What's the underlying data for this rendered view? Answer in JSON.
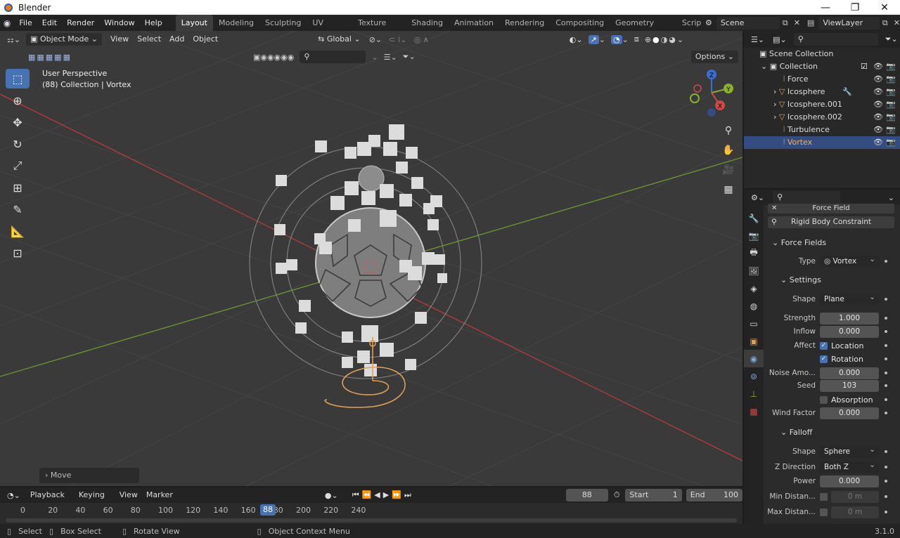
{
  "window": {
    "title": "Blender",
    "min": "—",
    "max": "❐",
    "close": "✕"
  },
  "menu": [
    "File",
    "Edit",
    "Render",
    "Window",
    "Help"
  ],
  "workspaces": [
    "Layout",
    "Modeling",
    "Sculpting",
    "UV Editing",
    "Texture Paint",
    "Shading",
    "Animation",
    "Rendering",
    "Compositing",
    "Geometry Nodes",
    "Scripting"
  ],
  "scene": {
    "name": "Scene",
    "view_layer": "ViewLayer"
  },
  "viewport": {
    "mode": "Object Mode",
    "menus": [
      "View",
      "Select",
      "Add",
      "Object"
    ],
    "orientation": "Global",
    "options": "Options",
    "perspective": "User Perspective",
    "collection_info": "(88) Collection | Vortex",
    "last_op": "Move",
    "gizmo": {
      "x": "X",
      "y": "Y",
      "z": "Z"
    }
  },
  "outliner": {
    "root": "Scene Collection",
    "collection": "Collection",
    "items": [
      "Force",
      "Icosphere",
      "Icosphere.001",
      "Icosphere.002",
      "Turbulence",
      "Vortex"
    ],
    "selected": "Vortex"
  },
  "properties": {
    "top_buttons": [
      "Force Field",
      "Rigid Body Constraint"
    ],
    "force_fields_header": "Force Fields",
    "type_label": "Type",
    "type_value": "Vortex",
    "settings_header": "Settings",
    "shape_label": "Shape",
    "shape_value": "Plane",
    "strength_label": "Strength",
    "strength_value": "1.000",
    "inflow_label": "Inflow",
    "inflow_value": "0.000",
    "affect_label": "Affect",
    "affect_location": "Location",
    "affect_rotation": "Rotation",
    "noise_label": "Noise Amo...",
    "noise_value": "0.000",
    "seed_label": "Seed",
    "seed_value": "103",
    "absorption": "Absorption",
    "wind_label": "Wind Factor",
    "wind_value": "0.000",
    "falloff_header": "Falloff",
    "falloff_shape_label": "Shape",
    "falloff_shape_value": "Sphere",
    "zdir_label": "Z Direction",
    "zdir_value": "Both Z",
    "power_label": "Power",
    "power_value": "0.000",
    "min_label": "Min Distan...",
    "min_value": "0 m",
    "max_label": "Max Distan...",
    "max_value": "0 m"
  },
  "timeline": {
    "menus": [
      "Playback",
      "Keying",
      "View",
      "Marker"
    ],
    "current_frame": "88",
    "start_label": "Start",
    "start": "1",
    "end_label": "End",
    "end": "100",
    "ticks": [
      "0",
      "20",
      "40",
      "60",
      "80",
      "100",
      "120",
      "140",
      "160",
      "180",
      "200",
      "220",
      "240"
    ]
  },
  "status": {
    "select": "Select",
    "box_select": "Box Select",
    "rotate_view": "Rotate View",
    "context_menu": "Object Context Menu",
    "version": "3.1.0"
  },
  "colors": {
    "accent": "#4772b3",
    "selection": "#334d80",
    "viewport_bg": "#3a3a3a",
    "x_axis": "#b83a3a",
    "y_axis": "#6a9a2a",
    "curve": "#e0a050"
  }
}
